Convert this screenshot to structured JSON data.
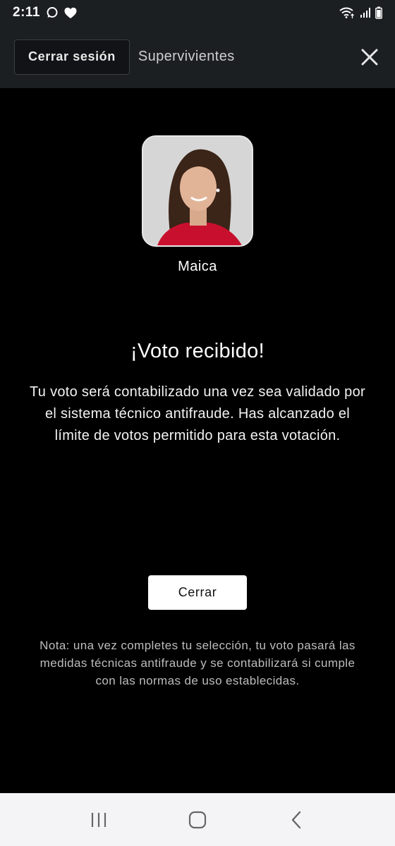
{
  "status_bar": {
    "time": "2:11",
    "icons": [
      "chat-bubble-icon",
      "heart-icon",
      "wifi-icon",
      "signal-icon",
      "battery-icon"
    ]
  },
  "header": {
    "logout_label": "Cerrar sesión",
    "title": "Supervivientes",
    "close_icon": "close-icon"
  },
  "candidate": {
    "name": "Maica"
  },
  "result": {
    "title": "¡Voto recibido!",
    "message": "Tu voto será contabilizado una vez sea validado por el sistema técnico antifraude. Has alcanzado el límite de votos permitido para esta votación."
  },
  "actions": {
    "close_label": "Cerrar"
  },
  "note": {
    "text": "Nota: una vez completes tu selección, tu voto pasará las medidas técnicas antifraude y se contabilizará si cumple con las normas de uso establecidas."
  },
  "nav": {
    "items": [
      "recent-apps-icon",
      "home-icon",
      "back-icon"
    ]
  },
  "colors": {
    "background": "#000000",
    "header": "#1c1f22",
    "avatar_shirt": "#c8102e"
  }
}
